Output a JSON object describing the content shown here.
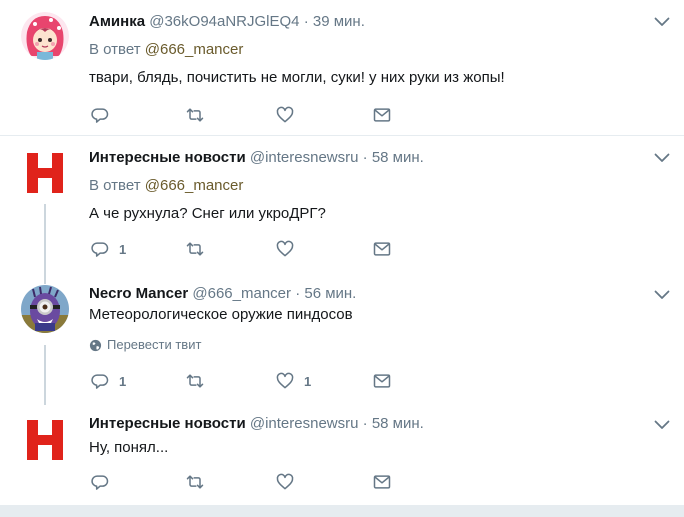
{
  "tweets": [
    {
      "name": "Аминка",
      "handle": "@36kO94aNRJGlEQ4",
      "dot": "·",
      "time": "39 мин.",
      "reply_prefix": "В ответ",
      "reply_to": "@666_mancer",
      "text": "твари, блядь, почистить не могли, суки! у них руки из жопы!",
      "reply_count": "",
      "retweet_count": "",
      "like_count": ""
    },
    {
      "name": "Интересные новости",
      "handle": "@interesnewsru",
      "dot": "·",
      "time": "58 мин.",
      "reply_prefix": "В ответ",
      "reply_to": "@666_mancer",
      "text": "А че рухнула? Снег или укроДРГ?",
      "reply_count": "1",
      "retweet_count": "",
      "like_count": ""
    },
    {
      "name": "Necro Mancer",
      "handle": "@666_mancer",
      "dot": "·",
      "time": "56 мин.",
      "text": "Метеорологическое оружие пиндосов",
      "translate": "Перевести твит",
      "reply_count": "1",
      "retweet_count": "",
      "like_count": "1"
    },
    {
      "name": "Интересные новости",
      "handle": "@interesnewsru",
      "dot": "·",
      "time": "58 мин.",
      "text": "Ну, понял...",
      "reply_count": "",
      "retweet_count": "",
      "like_count": ""
    }
  ],
  "icons": {
    "reply": "reply-icon",
    "retweet": "retweet-icon",
    "like": "heart-icon",
    "dm": "envelope-icon",
    "more": "chevron-down-icon",
    "globe": "globe-icon"
  },
  "colors": {
    "name": "#14171a",
    "secondary": "#657786",
    "mention": "#6a5b2c",
    "divider": "#e6ecf0",
    "brand_red": "#e0231b"
  }
}
